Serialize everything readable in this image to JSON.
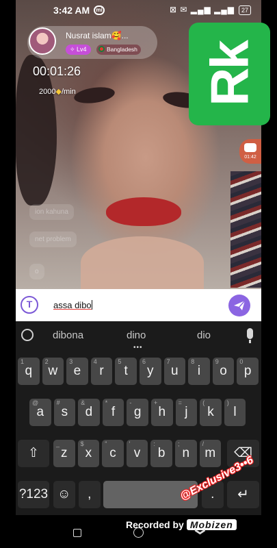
{
  "status_bar": {
    "time": "3:42 AM",
    "mi": "mi",
    "icons": "⊠ ✉ ▂▄▆ ▂▄▆",
    "battery": "27"
  },
  "host": {
    "name": "Nusrat islam🥰...",
    "level": "✧ Lv4",
    "country": "Bangladesh",
    "timer": "00:01:26",
    "rate_value": "2000",
    "rate_unit": "/min"
  },
  "logo": {
    "text": "Rk"
  },
  "side_widget": {
    "time": "01:42"
  },
  "chat": {
    "line1": "ion kahuna",
    "line2": "net problem",
    "line3": "o"
  },
  "input": {
    "value": "assa dibo"
  },
  "suggestions": [
    "dibona",
    "dino",
    "dio"
  ],
  "keyboard": {
    "row1": [
      {
        "k": "q",
        "h": "1"
      },
      {
        "k": "w",
        "h": "2"
      },
      {
        "k": "e",
        "h": "3"
      },
      {
        "k": "r",
        "h": "4"
      },
      {
        "k": "t",
        "h": "5"
      },
      {
        "k": "y",
        "h": "6"
      },
      {
        "k": "u",
        "h": "7"
      },
      {
        "k": "i",
        "h": "8"
      },
      {
        "k": "o",
        "h": "9"
      },
      {
        "k": "p",
        "h": "0"
      }
    ],
    "row2": [
      {
        "k": "a",
        "h": "@"
      },
      {
        "k": "s",
        "h": "#"
      },
      {
        "k": "d",
        "h": "&"
      },
      {
        "k": "f",
        "h": "*"
      },
      {
        "k": "g",
        "h": "-"
      },
      {
        "k": "h",
        "h": "+"
      },
      {
        "k": "j",
        "h": "="
      },
      {
        "k": "k",
        "h": "("
      },
      {
        "k": "l",
        "h": ")"
      }
    ],
    "row3": [
      {
        "k": "z",
        "h": "_"
      },
      {
        "k": "x",
        "h": "$"
      },
      {
        "k": "c",
        "h": "\""
      },
      {
        "k": "v",
        "h": "'"
      },
      {
        "k": "b",
        "h": ":"
      },
      {
        "k": "n",
        "h": ";"
      },
      {
        "k": "m",
        "h": "/"
      }
    ],
    "symbols": "?123",
    "comma": ",",
    "period": ".",
    "shift": "⇧",
    "backspace": "⌫",
    "emoji": "☺",
    "enter": "↵"
  },
  "watermark": "@Exclusive3••6",
  "recording": {
    "prefix": "Recorded by",
    "brand": "Mobizen"
  }
}
